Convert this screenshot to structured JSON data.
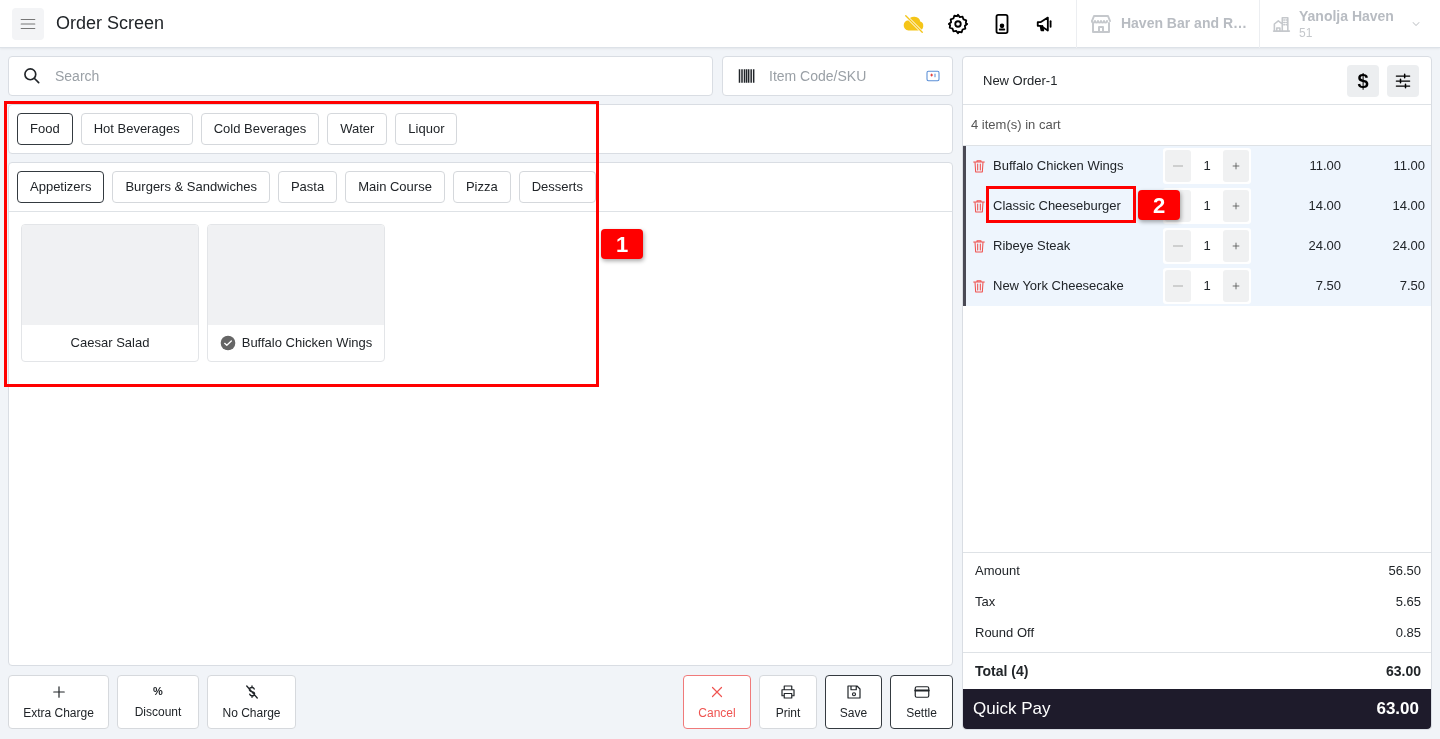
{
  "header": {
    "title": "Order Screen",
    "store": "Haven Bar and R…",
    "account": {
      "name": "Yanolja Haven",
      "number": "51"
    }
  },
  "search": {
    "placeholder": "Search"
  },
  "sku": {
    "placeholder": "Item Code/SKU"
  },
  "categories": [
    {
      "label": "Food",
      "selected": true
    },
    {
      "label": "Hot Beverages",
      "selected": false
    },
    {
      "label": "Cold Beverages",
      "selected": false
    },
    {
      "label": "Water",
      "selected": false
    },
    {
      "label": "Liquor",
      "selected": false
    }
  ],
  "subcategories": [
    {
      "label": "Appetizers",
      "selected": true
    },
    {
      "label": "Burgers & Sandwiches",
      "selected": false
    },
    {
      "label": "Pasta",
      "selected": false
    },
    {
      "label": "Main Course",
      "selected": false
    },
    {
      "label": "Pizza",
      "selected": false
    },
    {
      "label": "Desserts",
      "selected": false
    }
  ],
  "products": [
    {
      "name": "Caesar Salad",
      "checked": false
    },
    {
      "name": "Buffalo Chicken Wings",
      "checked": true
    }
  ],
  "actions": [
    {
      "label": "Extra Charge",
      "kind": "plus"
    },
    {
      "label": "Discount",
      "kind": "percent",
      "symbol": "%"
    },
    {
      "label": "No Charge",
      "kind": "nocharge"
    },
    {
      "label": "Cancel",
      "kind": "cancel"
    },
    {
      "label": "Print",
      "kind": "print"
    },
    {
      "label": "Save",
      "kind": "save"
    },
    {
      "label": "Settle",
      "kind": "settle"
    }
  ],
  "order": {
    "title": "New Order-1",
    "currency": "$",
    "count_label": "4 item(s) in cart",
    "items": [
      {
        "name": "Buffalo Chicken Wings",
        "qty": "1",
        "price": "11.00",
        "total": "11.00"
      },
      {
        "name": "Classic Cheeseburger",
        "qty": "1",
        "price": "14.00",
        "total": "14.00"
      },
      {
        "name": "Ribeye Steak",
        "qty": "1",
        "price": "24.00",
        "total": "24.00"
      },
      {
        "name": "New York Cheesecake",
        "qty": "1",
        "price": "7.50",
        "total": "7.50"
      }
    ],
    "summary": [
      {
        "label": "Amount",
        "value": "56.50"
      },
      {
        "label": "Tax",
        "value": "5.65"
      },
      {
        "label": "Round Off",
        "value": "0.85"
      }
    ],
    "total": {
      "label": "Total (4)",
      "value": "63.00"
    },
    "quick_pay": {
      "label": "Quick Pay",
      "value": "63.00"
    }
  },
  "annotations": [
    {
      "label": "1"
    },
    {
      "label": "2"
    }
  ]
}
